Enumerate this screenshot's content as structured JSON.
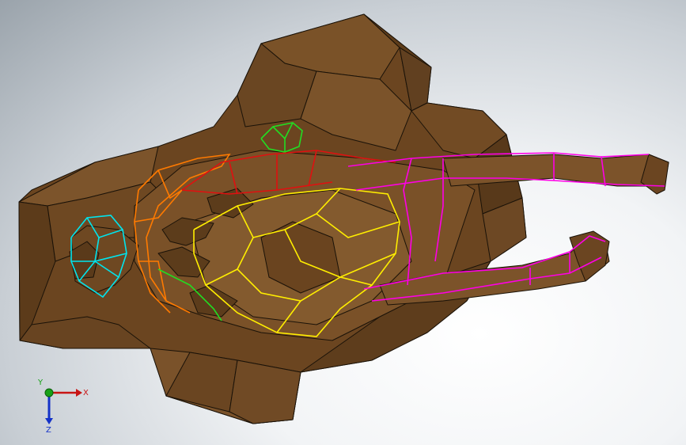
{
  "viewport": {
    "background": "#c9cfd5",
    "model_color": "#6e4a21",
    "edge_color": "#1a1208"
  },
  "triad": {
    "x_label": "X",
    "y_label": "Y",
    "z_label": "Z",
    "x_color": "#c81414",
    "y_color": "#18a018",
    "z_color": "#1432c8"
  },
  "highlight_colors": {
    "head": "#00e5ee",
    "neck": "#ff7a00",
    "collar": "#e01010",
    "ear": "#22dd22",
    "body": "#ffee00",
    "legs": "#ff00e6"
  }
}
